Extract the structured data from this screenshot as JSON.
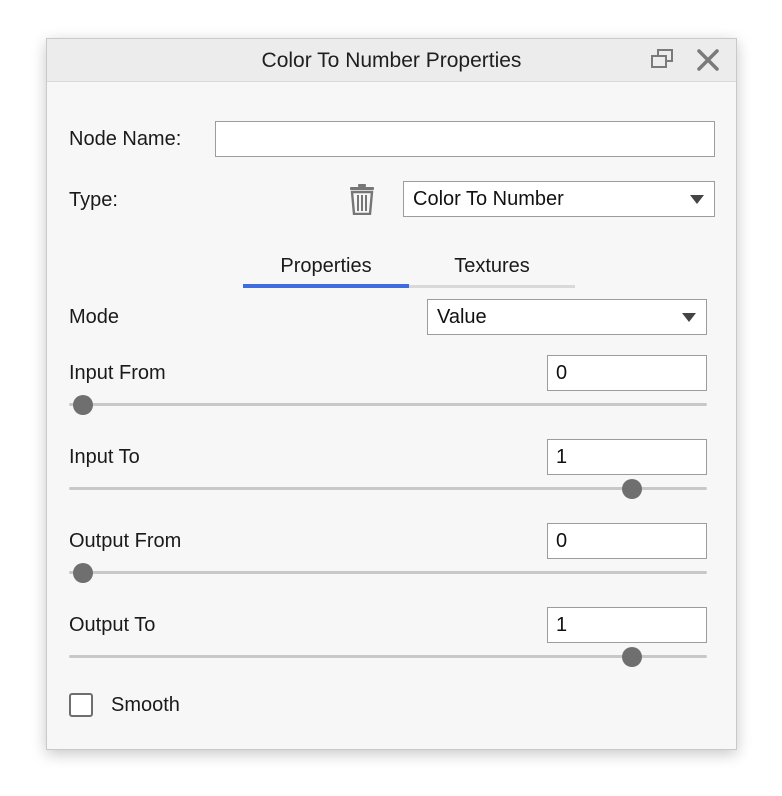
{
  "window": {
    "title": "Color To Number Properties",
    "icons": {
      "restore": "restore-window-icon",
      "close": "close-icon",
      "delete": "trash-icon"
    }
  },
  "node_name": {
    "label": "Node Name:",
    "value": ""
  },
  "type": {
    "label": "Type:",
    "selected": "Color To Number"
  },
  "tabs": [
    {
      "label": "Properties",
      "active": true
    },
    {
      "label": "Textures",
      "active": false
    }
  ],
  "properties": {
    "mode": {
      "label": "Mode",
      "selected": "Value"
    },
    "input_from": {
      "label": "Input From",
      "value": "0",
      "slider_fraction": 0.0
    },
    "input_to": {
      "label": "Input To",
      "value": "1",
      "slider_fraction": 0.9
    },
    "output_from": {
      "label": "Output From",
      "value": "0",
      "slider_fraction": 0.0
    },
    "output_to": {
      "label": "Output To",
      "value": "1",
      "slider_fraction": 0.9
    },
    "smooth": {
      "label": "Smooth",
      "checked": false
    }
  },
  "colors": {
    "accent": "#3f6de0",
    "tab_inactive_underline": "#d9d9d9",
    "slider_thumb": "#6f6f6f",
    "slider_track": "#c8c8c8"
  }
}
